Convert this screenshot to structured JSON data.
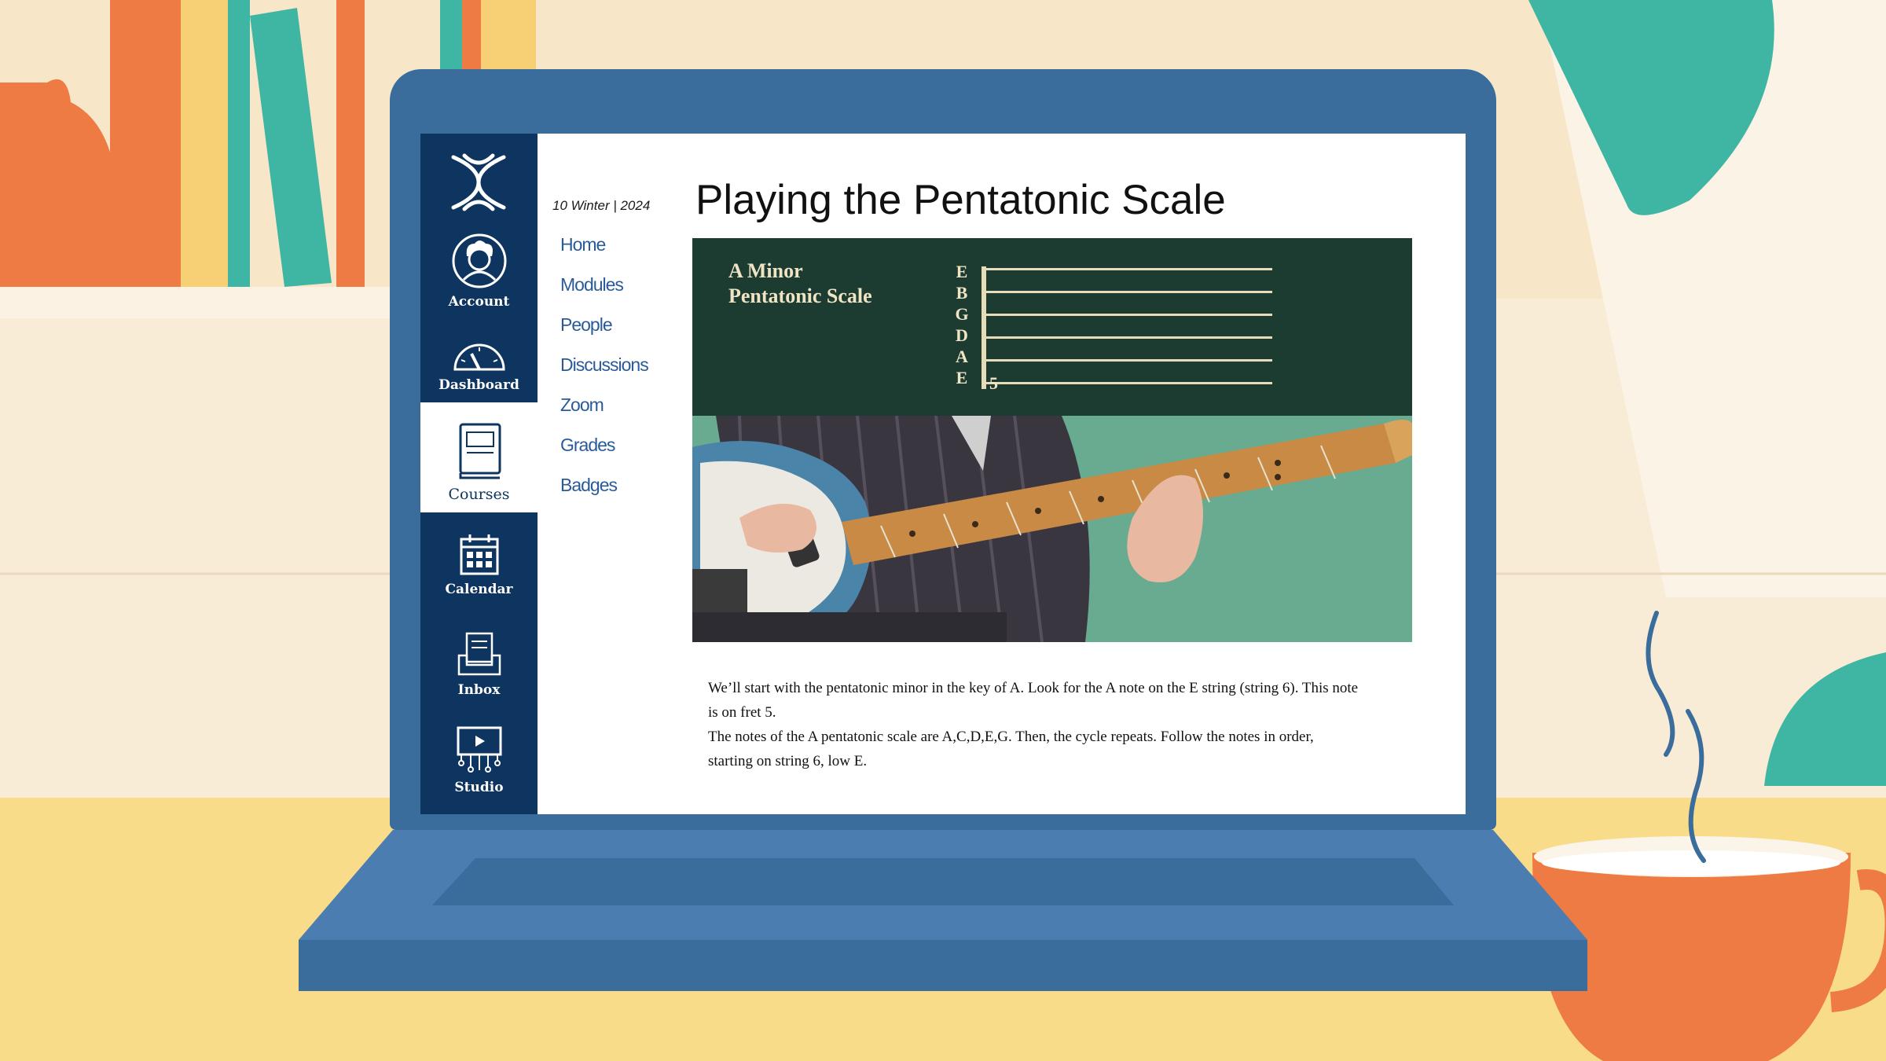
{
  "nav_rail": {
    "items": [
      {
        "label": "Account",
        "icon": "account-avatar-icon"
      },
      {
        "label": "Dashboard",
        "icon": "dashboard-gauge-icon"
      },
      {
        "label": "Courses",
        "icon": "courses-book-icon",
        "active": true
      },
      {
        "label": "Calendar",
        "icon": "calendar-icon"
      },
      {
        "label": "Inbox",
        "icon": "inbox-icon"
      },
      {
        "label": "Studio",
        "icon": "studio-video-icon"
      }
    ]
  },
  "course_nav": {
    "term": "10 Winter | 2024",
    "links": [
      "Home",
      "Modules",
      "People",
      "Discussions",
      "Zoom",
      "Grades",
      "Badges"
    ]
  },
  "main": {
    "title": "Playing the Pentatonic Scale",
    "banner": {
      "title": "A Minor\nPentatonic Scale",
      "strings": [
        "E",
        "B",
        "G",
        "D",
        "A",
        "E"
      ],
      "fret_number": "5"
    },
    "paragraphs": [
      "We’ll start with the pentatonic minor in the key of A. Look for the A note on the E string (string 6). This note is on fret 5.",
      "The notes of the A pentatonic scale are A,C,D,E,G. Then, the cycle repeats. Follow the notes in order, starting on string 6, low E."
    ]
  },
  "colors": {
    "rail": "#0e3560",
    "link": "#2a5b98",
    "banner": "#1c3c31",
    "laptop": "#3a6c9c"
  }
}
